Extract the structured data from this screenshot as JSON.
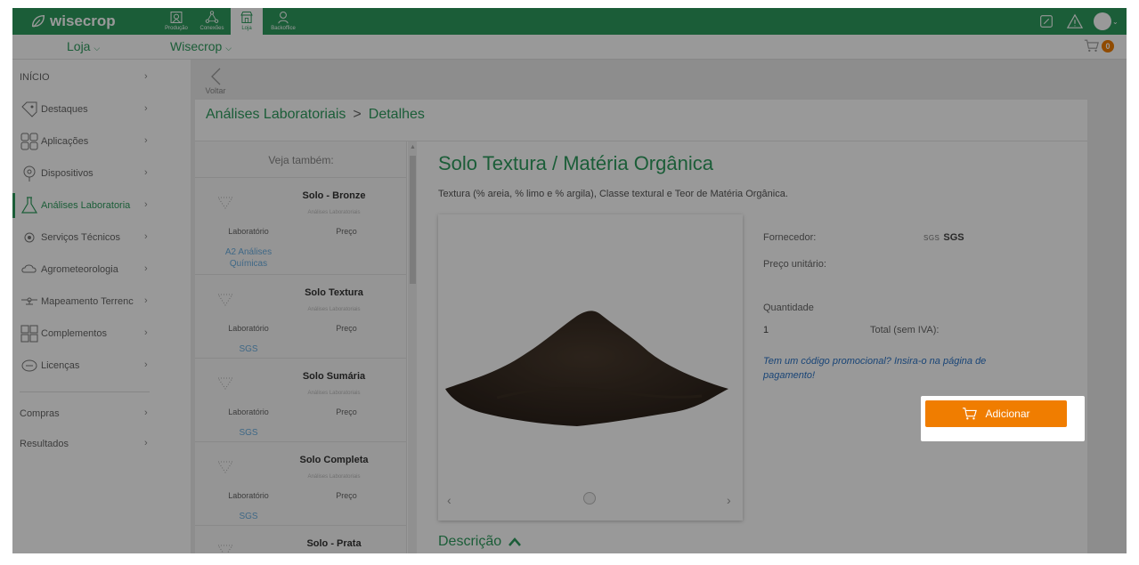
{
  "app": {
    "brand": "wisecrop",
    "modules": [
      {
        "label": "Produção",
        "icon": "building-icon",
        "active": false
      },
      {
        "label": "Conexões",
        "icon": "network-icon",
        "active": false
      },
      {
        "label": "Loja",
        "icon": "store-icon",
        "active": true
      },
      {
        "label": "Backoffice",
        "icon": "backoffice-icon",
        "active": false
      }
    ]
  },
  "subbar": {
    "store_select": "Loja",
    "org_select": "Wisecrop",
    "cart_count": "0"
  },
  "sidebar": {
    "items": [
      {
        "label": "INÍCIO",
        "icon": ""
      },
      {
        "label": "Destaques",
        "icon": "tag-icon"
      },
      {
        "label": "Aplicações",
        "icon": "apps-icon"
      },
      {
        "label": "Dispositivos",
        "icon": "device-icon"
      },
      {
        "label": "Análises Laboratoria",
        "icon": "flask-icon",
        "active": true
      },
      {
        "label": "Serviços Técnicos",
        "icon": "services-icon"
      },
      {
        "label": "Agrometeorologia",
        "icon": "weather-icon"
      },
      {
        "label": "Mapeamento Terrenc",
        "icon": "drone-icon"
      },
      {
        "label": "Complementos",
        "icon": "complements-icon"
      },
      {
        "label": "Licenças",
        "icon": "license-icon"
      },
      {
        "label": "Compras",
        "icon": ""
      },
      {
        "label": "Resultados",
        "icon": ""
      }
    ]
  },
  "back": {
    "label": "Voltar"
  },
  "breadcrumb": {
    "parent": "Análises Laboratoriais",
    "separator": ">",
    "current": "Detalhes"
  },
  "see_also": {
    "title": "Veja também:",
    "lab_label": "Laboratório",
    "price_label": "Preço",
    "items": [
      {
        "name": "Solo - Bronze",
        "category": "Análises Laboratoriais",
        "lab": "A2 Análises Químicas"
      },
      {
        "name": "Solo Textura",
        "category": "Análises Laboratoriais",
        "lab": "SGS"
      },
      {
        "name": "Solo Sumária",
        "category": "Análises Laboratoriais",
        "lab": "SGS"
      },
      {
        "name": "Solo Completa",
        "category": "Análises Laboratoriais",
        "lab": "SGS"
      },
      {
        "name": "Solo - Prata",
        "category": "",
        "lab": ""
      }
    ]
  },
  "product": {
    "title": "Solo Textura / Matéria Orgânica",
    "description": "Textura (% areia, % limo e % argila), Classe textural e Teor de Matéria Orgânica.",
    "supplier_label": "Fornecedor:",
    "supplier_logo": "SGS",
    "supplier_name": "SGS",
    "unit_price_label": "Preço unitário:",
    "quantity_label": "Quantidade",
    "quantity_value": "1",
    "total_label": "Total (sem IVA):",
    "promo_text": "Tem um código promocional? Insira-o na página de pagamento!",
    "add_button": "Adicionar",
    "description_heading": "Descrição"
  }
}
